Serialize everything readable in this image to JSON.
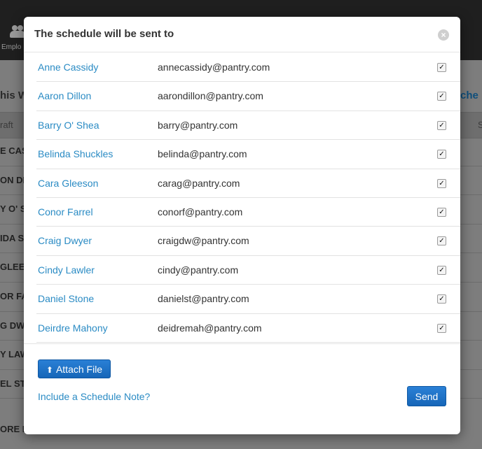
{
  "background": {
    "nav_label": "Emplo",
    "week_text": "his W",
    "switch_text": "tche",
    "column_head": "raft",
    "column_head_right": "S",
    "rows": [
      "E CASS",
      "ON DIL",
      "Y O' S",
      "IDA SH",
      "GLEES",
      "OR FAI",
      "G DWY",
      "Y LAW",
      "EL STO"
    ],
    "last_row": "ORE MAHONY"
  },
  "modal": {
    "title": "The schedule will be sent to",
    "close_symbol": "×",
    "recipients": [
      {
        "name": "Anne Cassidy",
        "email": "annecassidy@pantry.com",
        "checked": true
      },
      {
        "name": "Aaron Dillon",
        "email": "aarondillon@pantry.com",
        "checked": true
      },
      {
        "name": "Barry O' Shea",
        "email": "barry@pantry.com",
        "checked": true
      },
      {
        "name": "Belinda Shuckles",
        "email": "belinda@pantry.com",
        "checked": true
      },
      {
        "name": "Cara Gleeson",
        "email": "carag@pantry.com",
        "checked": true
      },
      {
        "name": "Conor Farrel",
        "email": "conorf@pantry.com",
        "checked": true
      },
      {
        "name": "Craig Dwyer",
        "email": "craigdw@pantry.com",
        "checked": true
      },
      {
        "name": "Cindy Lawler",
        "email": "cindy@pantry.com",
        "checked": true
      },
      {
        "name": "Daniel Stone",
        "email": "danielst@pantry.com",
        "checked": true
      },
      {
        "name": "Deirdre Mahony",
        "email": "deidremah@pantry.com",
        "checked": true
      }
    ],
    "attach_label": "Attach File",
    "note_link": "Include a Schedule Note?",
    "send_label": "Send"
  },
  "colors": {
    "link": "#2a8bc4",
    "primary_button": "#1a6fc4"
  }
}
